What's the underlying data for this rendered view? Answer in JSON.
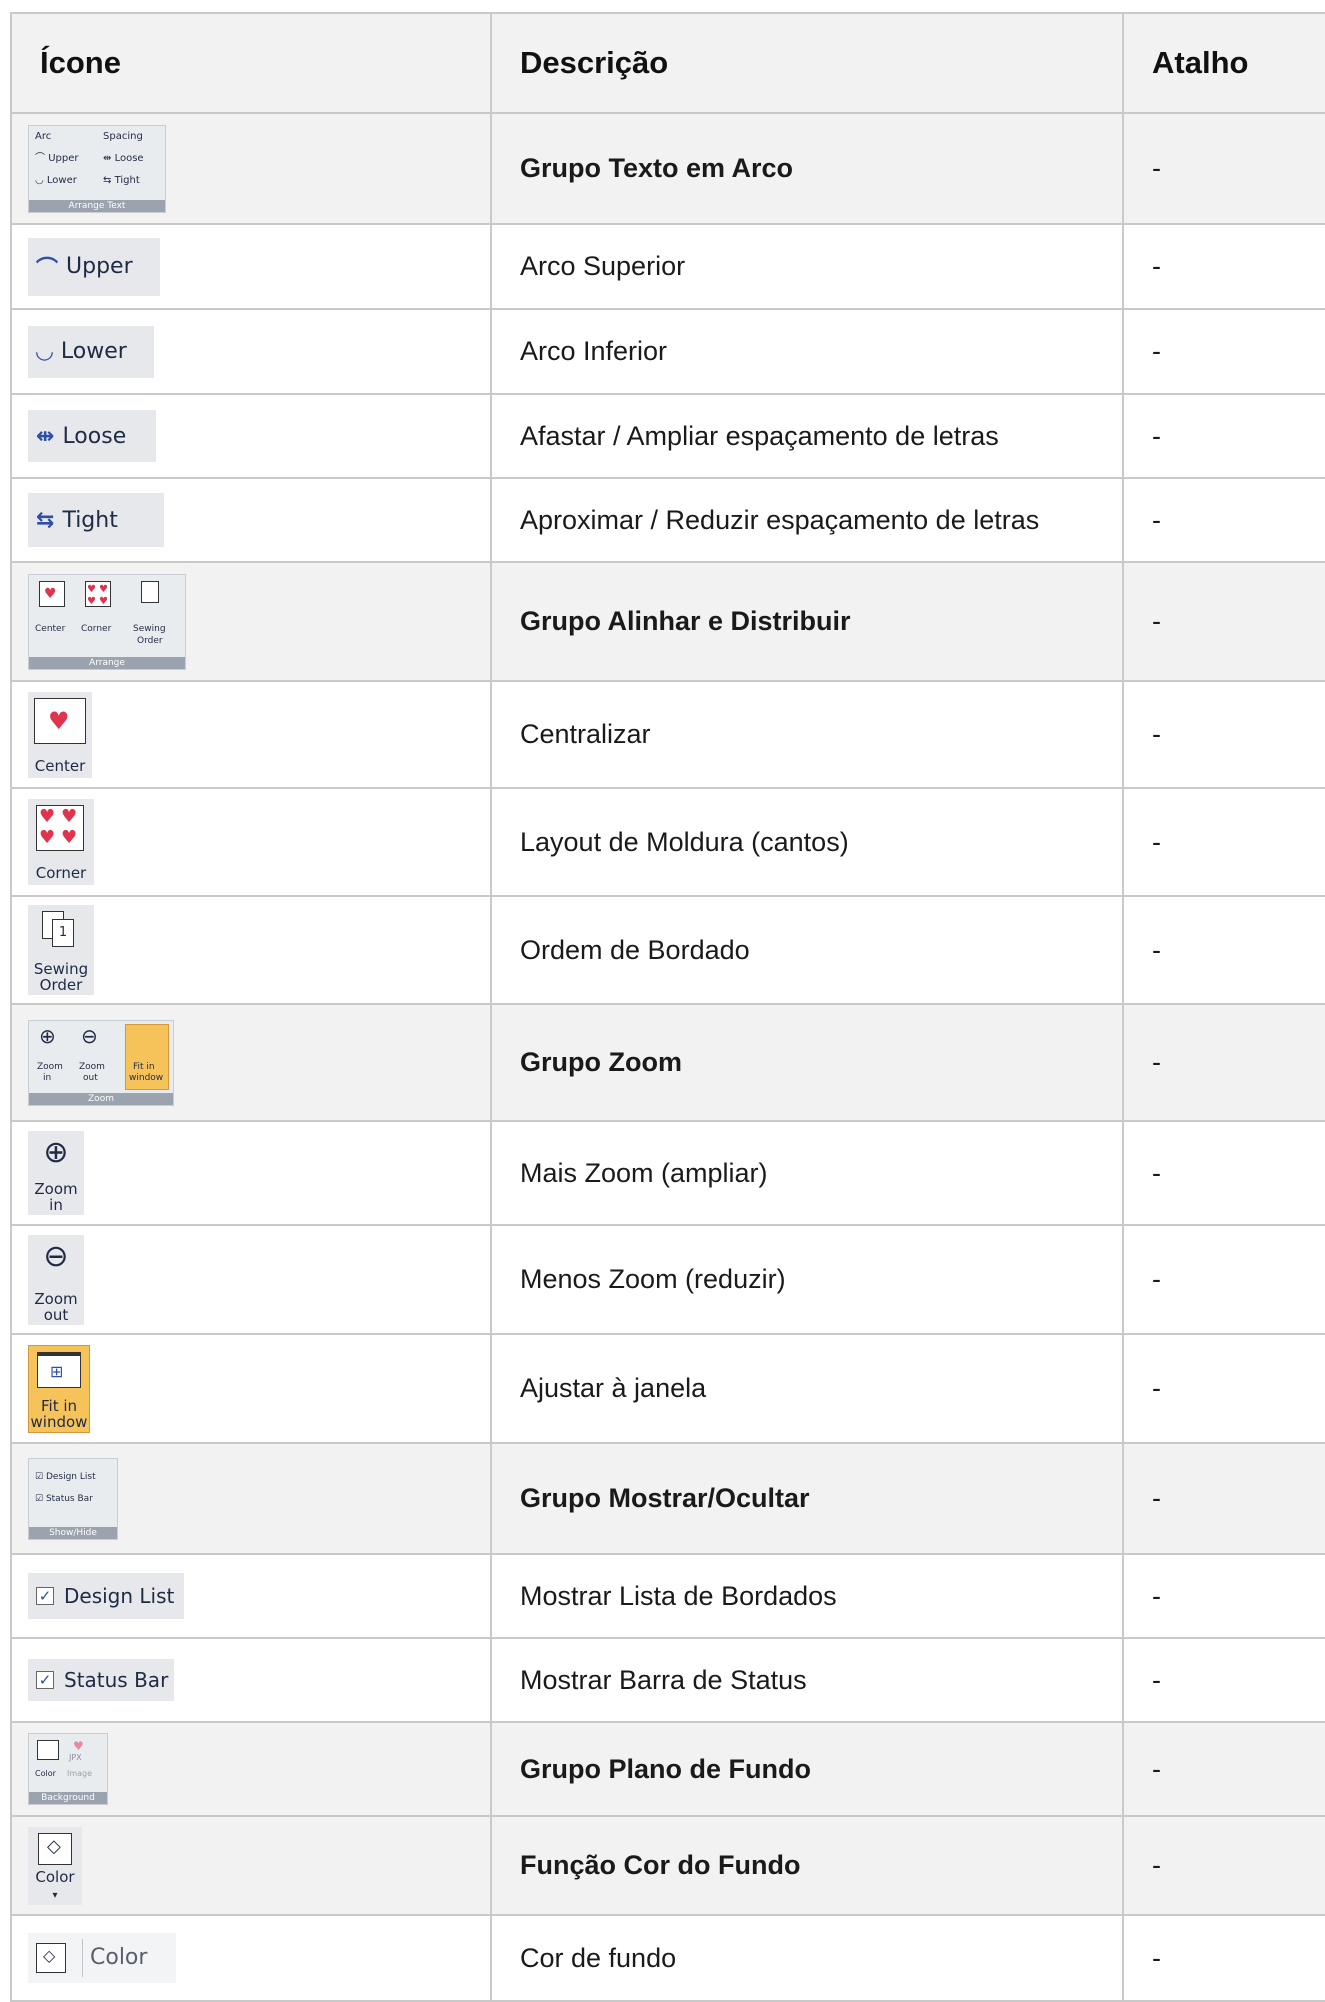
{
  "headers": {
    "icon": "Ícone",
    "description": "Descrição",
    "shortcut": "Atalho"
  },
  "icons": {
    "arrange_text_group": {
      "arc": "Arc",
      "spacing": "Spacing",
      "upper": "Upper",
      "loose": "Loose",
      "lower": "Lower",
      "tight": "Tight",
      "caption": "Arrange Text"
    },
    "upper": "Upper",
    "lower": "Lower",
    "loose": "Loose",
    "tight": "Tight",
    "arrange_group": {
      "center": "Center",
      "corner": "Corner",
      "sewing_order_1": "Sewing",
      "sewing_order_2": "Order",
      "caption": "Arrange"
    },
    "center": "Center",
    "corner": "Corner",
    "sewing_order_1": "Sewing",
    "sewing_order_2": "Order",
    "zoom_group": {
      "zoom_in_1": "Zoom",
      "zoom_in_2": "in",
      "zoom_out_1": "Zoom",
      "zoom_out_2": "out",
      "fit_1": "Fit in",
      "fit_2": "window",
      "caption": "Zoom"
    },
    "zoom_in_1": "Zoom",
    "zoom_in_2": "in",
    "zoom_out_1": "Zoom",
    "zoom_out_2": "out",
    "fit_1": "Fit in",
    "fit_2": "window",
    "show_hide_group": {
      "design_list": "Design List",
      "status_bar": "Status Bar",
      "caption": "Show/Hide"
    },
    "design_list": "Design List",
    "status_bar": "Status Bar",
    "background_group": {
      "color": "Color",
      "image": "Image",
      "jpx": "JPX",
      "caption": "Background"
    },
    "color_button": "Color",
    "color_text": "Color"
  },
  "rows": [
    {
      "description": "Grupo Texto em Arco",
      "shortcut": "-"
    },
    {
      "description": "Arco Superior",
      "shortcut": "-"
    },
    {
      "description": "Arco Inferior",
      "shortcut": "-"
    },
    {
      "description": "Afastar / Ampliar espaçamento de letras",
      "shortcut": "-"
    },
    {
      "description": "Aproximar / Reduzir espaçamento de letras",
      "shortcut": "-"
    },
    {
      "description": "Grupo Alinhar e Distribuir",
      "shortcut": "-"
    },
    {
      "description": "Centralizar",
      "shortcut": "-"
    },
    {
      "description": "Layout de Moldura (cantos)",
      "shortcut": "-"
    },
    {
      "description": "Ordem de Bordado",
      "shortcut": "-"
    },
    {
      "description": "Grupo Zoom",
      "shortcut": "-"
    },
    {
      "description": "Mais Zoom (ampliar)",
      "shortcut": "-"
    },
    {
      "description": "Menos Zoom (reduzir)",
      "shortcut": "-"
    },
    {
      "description": "Ajustar à janela",
      "shortcut": "-"
    },
    {
      "description": "Grupo Mostrar/Ocultar",
      "shortcut": "-"
    },
    {
      "description": "Mostrar Lista de Bordados",
      "shortcut": "-"
    },
    {
      "description": "Mostrar Barra de Status",
      "shortcut": "-"
    },
    {
      "description": "Grupo Plano de Fundo",
      "shortcut": "-"
    },
    {
      "description": "Função Cor do Fundo",
      "shortcut": "-"
    },
    {
      "description": "Cor de fundo",
      "shortcut": "-"
    }
  ]
}
